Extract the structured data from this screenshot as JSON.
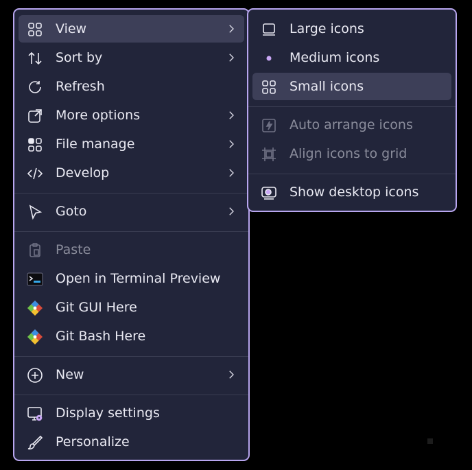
{
  "main_menu": {
    "items": [
      {
        "label": "View",
        "icon": "grid-icon",
        "has_submenu": true
      },
      {
        "label": "Sort by",
        "icon": "sort-arrows-icon",
        "has_submenu": true
      },
      {
        "label": "Refresh",
        "icon": "refresh-icon",
        "has_submenu": false
      },
      {
        "label": "More options",
        "icon": "open-external-icon",
        "has_submenu": true
      },
      {
        "label": "File manage",
        "icon": "apps-icon",
        "has_submenu": true
      },
      {
        "label": "Develop",
        "icon": "code-icon",
        "has_submenu": true
      },
      {
        "label": "Goto",
        "icon": "cursor-arrow-icon",
        "has_submenu": true
      },
      {
        "label": "Paste",
        "icon": "clipboard-icon",
        "has_submenu": false,
        "disabled": true
      },
      {
        "label": "Open in Terminal Preview",
        "icon": "terminal-icon",
        "has_submenu": false
      },
      {
        "label": "Git GUI Here",
        "icon": "git-icon",
        "has_submenu": false
      },
      {
        "label": "Git Bash Here",
        "icon": "git-icon",
        "has_submenu": false
      },
      {
        "label": "New",
        "icon": "plus-circle-icon",
        "has_submenu": true
      },
      {
        "label": "Display settings",
        "icon": "display-settings-icon",
        "has_submenu": false
      },
      {
        "label": "Personalize",
        "icon": "brush-icon",
        "has_submenu": false
      }
    ]
  },
  "view_submenu": {
    "items": [
      {
        "label": "Large icons",
        "icon": "monitor-icon"
      },
      {
        "label": "Medium icons",
        "icon": "bullet-icon",
        "selected": true
      },
      {
        "label": "Small icons",
        "icon": "grid-icon"
      },
      {
        "label": "Auto arrange icons",
        "icon": "auto-arrange-icon",
        "disabled": true
      },
      {
        "label": "Align icons to grid",
        "icon": "align-grid-icon",
        "disabled": true
      },
      {
        "label": "Show desktop icons",
        "icon": "desktop-toggle-icon"
      }
    ]
  },
  "colors": {
    "menu_bg": "#22253a",
    "border": "#b8a6ef",
    "highlight": "#3d3f58",
    "text": "#e9e9f2",
    "disabled_text": "#8a8c9b",
    "accent": "#c9a7f5"
  }
}
